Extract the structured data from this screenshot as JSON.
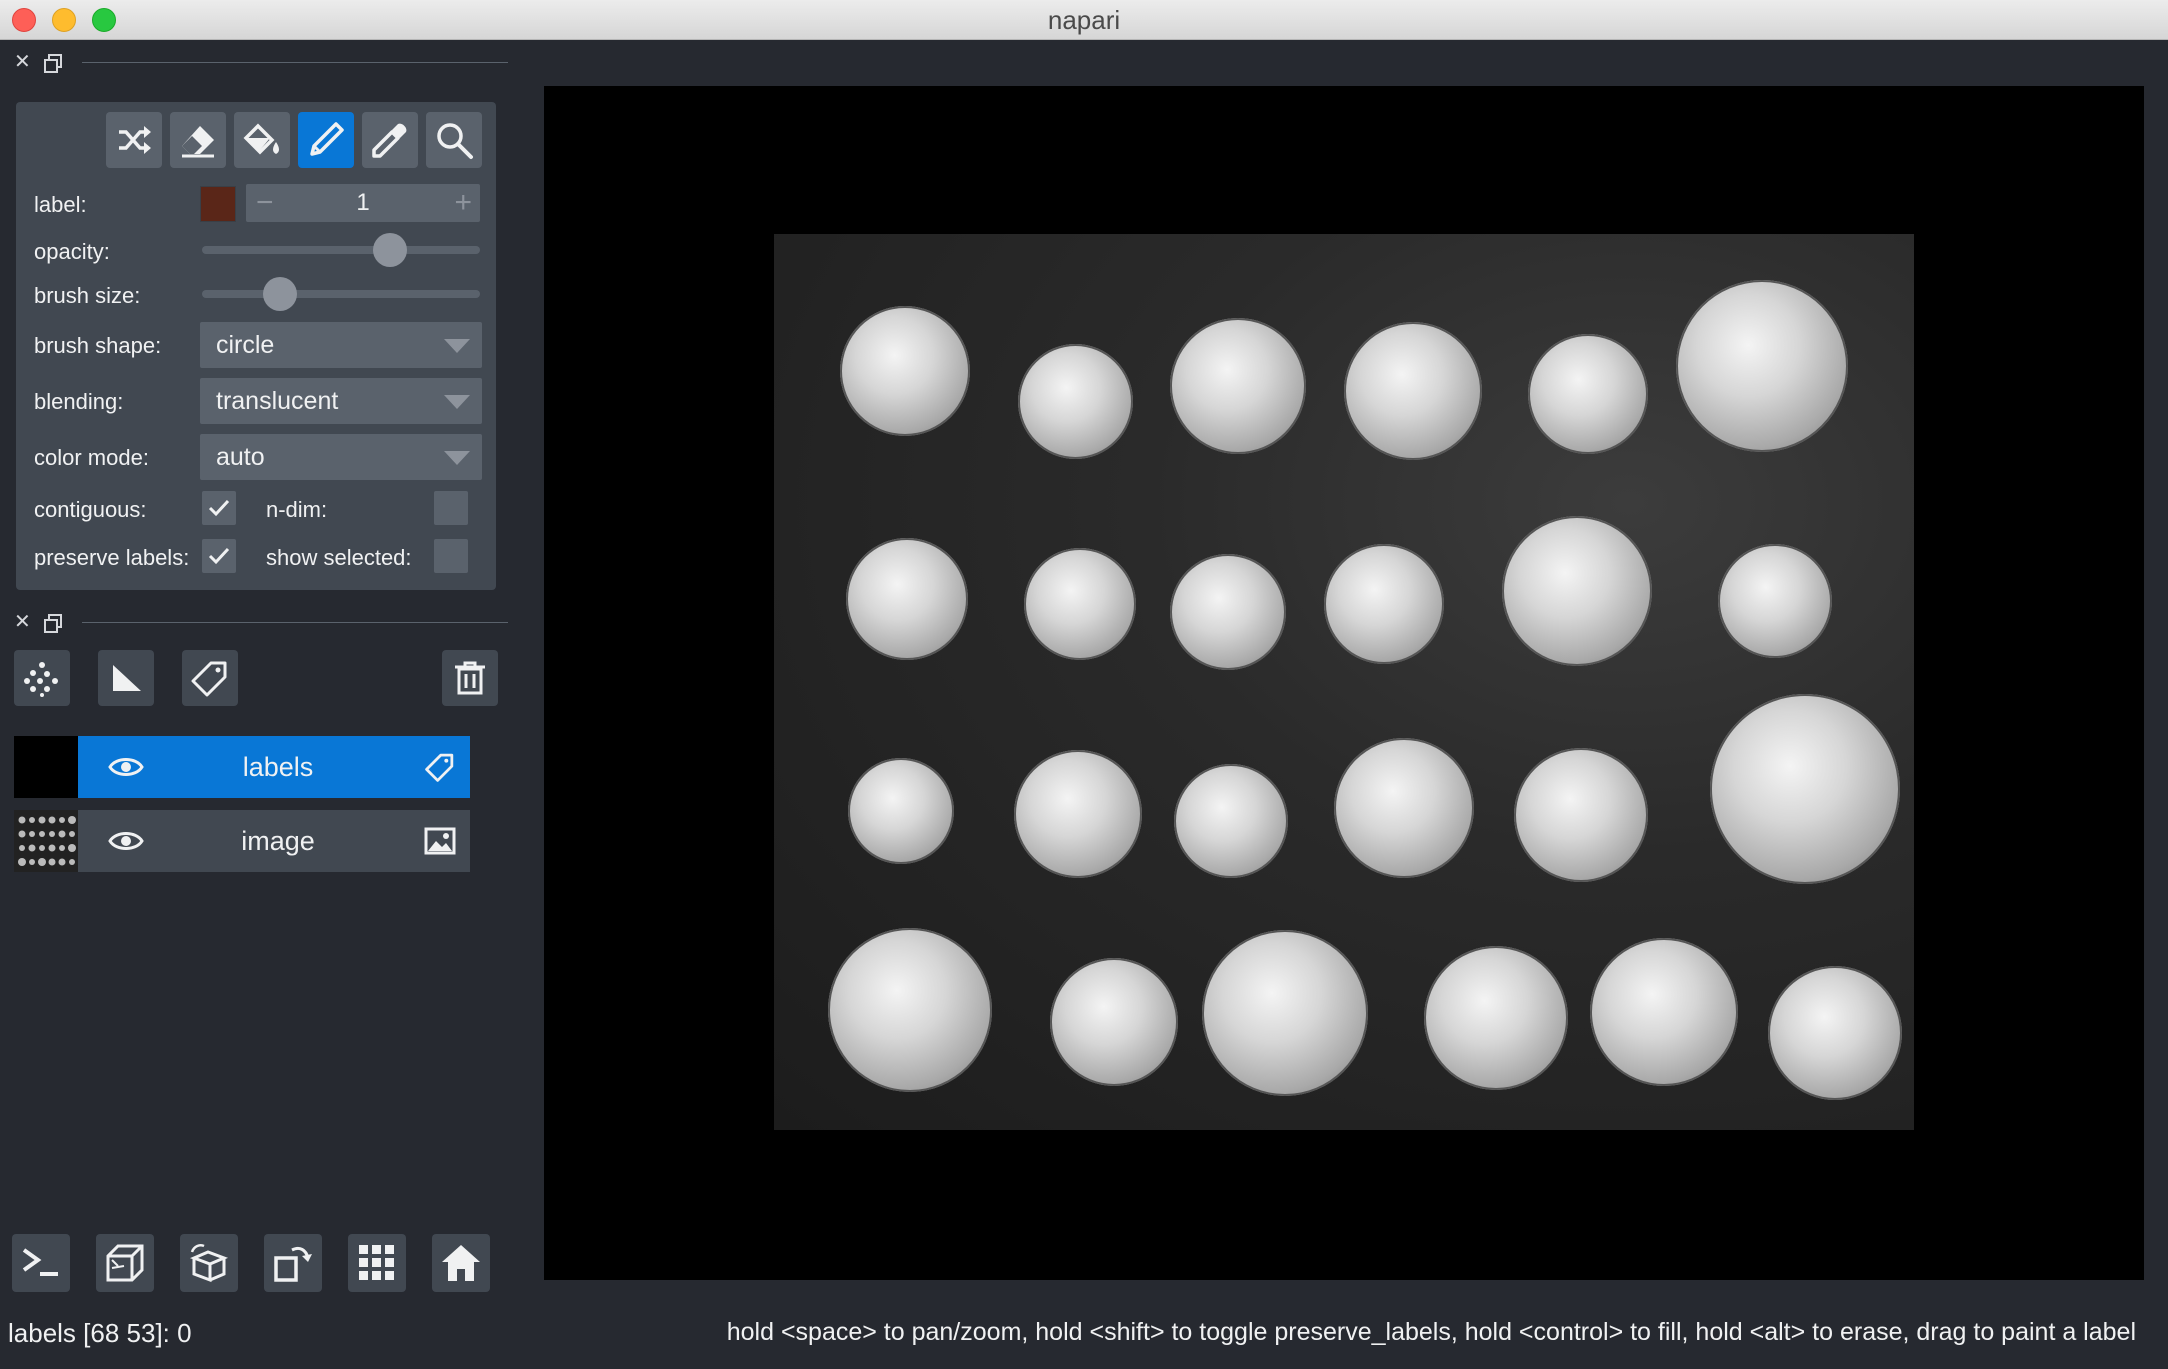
{
  "window": {
    "title": "napari"
  },
  "layer_controls": {
    "label_label": "label:",
    "label_value": "1",
    "label_color": "#5a2618",
    "minus": "−",
    "plus": "+",
    "opacity_label": "opacity:",
    "opacity_value": 0.7,
    "brush_size_label": "brush size:",
    "brush_size_value": 0.25,
    "brush_shape_label": "brush shape:",
    "brush_shape_value": "circle",
    "blending_label": "blending:",
    "blending_value": "translucent",
    "color_mode_label": "color mode:",
    "color_mode_value": "auto",
    "contiguous_label": "contiguous:",
    "contiguous_checked": true,
    "ndim_label": "n-dim:",
    "ndim_checked": false,
    "preserve_labels_label": "preserve labels:",
    "preserve_labels_checked": true,
    "show_selected_label": "show selected:",
    "show_selected_checked": false,
    "active_tool": "paint-brush"
  },
  "layers": [
    {
      "name": "labels",
      "visible": true,
      "selected": true,
      "type_icon": "label-tag-icon"
    },
    {
      "name": "image",
      "visible": true,
      "selected": false,
      "type_icon": "image-icon"
    }
  ],
  "status": {
    "left": "labels [68 53]: 0",
    "right": "hold <space> to pan/zoom, hold <shift> to toggle preserve_labels, hold <control> to fill, hold <alt> to erase, drag to paint a label"
  },
  "colors": {
    "accent": "#0977d6",
    "panel": "#414851",
    "background": "#262930",
    "control": "#5a626c"
  }
}
